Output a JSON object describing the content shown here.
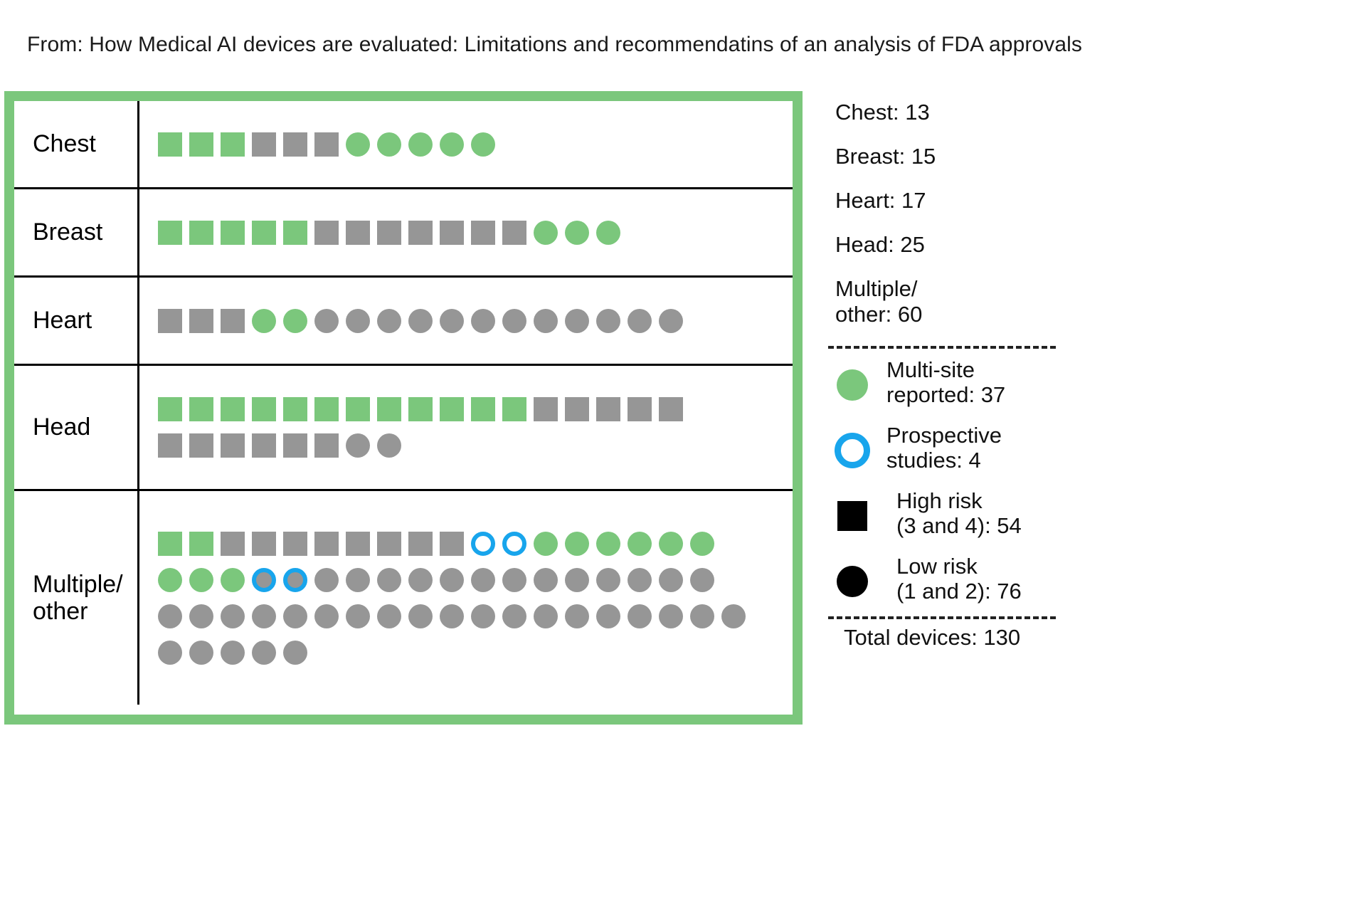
{
  "title": "From: How Medical AI devices are evaluated: Limitations and  recommendatins of an analysis of FDA approvals",
  "colors": {
    "green": "#7bc77c",
    "gray": "#969696",
    "blue": "#18a5ec",
    "black": "#000000"
  },
  "chart_data": {
    "type": "table",
    "title": "Medical AI device evaluations by body area",
    "categories": [
      "Chest",
      "Breast",
      "Heart",
      "Head",
      "Multiple/ other"
    ],
    "values": [
      13,
      15,
      17,
      25,
      60
    ],
    "legend": [
      "Multi-site reported",
      "Prospective studies",
      "High risk (3 and 4)",
      "Low risk (1 and 2)"
    ],
    "legend_values": [
      37,
      4,
      54,
      76
    ],
    "total": 130,
    "encoding": {
      "square": "High risk (3 and 4)",
      "circle": "Low risk (1 and 2)",
      "green_fill": "Multi-site reported",
      "gray_fill": "Not multi-site reported",
      "blue_ring": "Prospective study"
    }
  },
  "rows": [
    {
      "label": "Chest",
      "count": 13,
      "lines": [
        [
          {
            "shape": "sq",
            "fill": "green"
          },
          {
            "shape": "sq",
            "fill": "green"
          },
          {
            "shape": "sq",
            "fill": "green"
          },
          {
            "shape": "sq",
            "fill": "gray"
          },
          {
            "shape": "sq",
            "fill": "gray"
          },
          {
            "shape": "sq",
            "fill": "gray"
          },
          {
            "shape": "ci",
            "fill": "green"
          },
          {
            "shape": "ci",
            "fill": "green"
          },
          {
            "shape": "ci",
            "fill": "green"
          },
          {
            "shape": "ci",
            "fill": "green"
          },
          {
            "shape": "ci",
            "fill": "green"
          }
        ]
      ]
    },
    {
      "label": "Breast",
      "count": 15,
      "lines": [
        [
          {
            "shape": "sq",
            "fill": "green"
          },
          {
            "shape": "sq",
            "fill": "green"
          },
          {
            "shape": "sq",
            "fill": "green"
          },
          {
            "shape": "sq",
            "fill": "green"
          },
          {
            "shape": "sq",
            "fill": "green"
          },
          {
            "shape": "sq",
            "fill": "gray"
          },
          {
            "shape": "sq",
            "fill": "gray"
          },
          {
            "shape": "sq",
            "fill": "gray"
          },
          {
            "shape": "sq",
            "fill": "gray"
          },
          {
            "shape": "sq",
            "fill": "gray"
          },
          {
            "shape": "sq",
            "fill": "gray"
          },
          {
            "shape": "sq",
            "fill": "gray"
          },
          {
            "shape": "ci",
            "fill": "green"
          },
          {
            "shape": "ci",
            "fill": "green"
          },
          {
            "shape": "ci",
            "fill": "green"
          }
        ]
      ]
    },
    {
      "label": "Heart",
      "count": 17,
      "lines": [
        [
          {
            "shape": "sq",
            "fill": "gray"
          },
          {
            "shape": "sq",
            "fill": "gray"
          },
          {
            "shape": "sq",
            "fill": "gray"
          },
          {
            "shape": "ci",
            "fill": "green"
          },
          {
            "shape": "ci",
            "fill": "green"
          },
          {
            "shape": "ci",
            "fill": "gray"
          },
          {
            "shape": "ci",
            "fill": "gray"
          },
          {
            "shape": "ci",
            "fill": "gray"
          },
          {
            "shape": "ci",
            "fill": "gray"
          },
          {
            "shape": "ci",
            "fill": "gray"
          },
          {
            "shape": "ci",
            "fill": "gray"
          },
          {
            "shape": "ci",
            "fill": "gray"
          },
          {
            "shape": "ci",
            "fill": "gray"
          },
          {
            "shape": "ci",
            "fill": "gray"
          },
          {
            "shape": "ci",
            "fill": "gray"
          },
          {
            "shape": "ci",
            "fill": "gray"
          },
          {
            "shape": "ci",
            "fill": "gray"
          }
        ]
      ]
    },
    {
      "label": "Head",
      "count": 25,
      "lines": [
        [
          {
            "shape": "sq",
            "fill": "green"
          },
          {
            "shape": "sq",
            "fill": "green"
          },
          {
            "shape": "sq",
            "fill": "green"
          },
          {
            "shape": "sq",
            "fill": "green"
          },
          {
            "shape": "sq",
            "fill": "green"
          },
          {
            "shape": "sq",
            "fill": "green"
          },
          {
            "shape": "sq",
            "fill": "green"
          },
          {
            "shape": "sq",
            "fill": "green"
          },
          {
            "shape": "sq",
            "fill": "green"
          },
          {
            "shape": "sq",
            "fill": "green"
          },
          {
            "shape": "sq",
            "fill": "green"
          },
          {
            "shape": "sq",
            "fill": "green"
          },
          {
            "shape": "sq",
            "fill": "gray"
          },
          {
            "shape": "sq",
            "fill": "gray"
          },
          {
            "shape": "sq",
            "fill": "gray"
          },
          {
            "shape": "sq",
            "fill": "gray"
          },
          {
            "shape": "sq",
            "fill": "gray"
          }
        ],
        [
          {
            "shape": "sq",
            "fill": "gray"
          },
          {
            "shape": "sq",
            "fill": "gray"
          },
          {
            "shape": "sq",
            "fill": "gray"
          },
          {
            "shape": "sq",
            "fill": "gray"
          },
          {
            "shape": "sq",
            "fill": "gray"
          },
          {
            "shape": "sq",
            "fill": "gray"
          },
          {
            "shape": "ci",
            "fill": "gray"
          },
          {
            "shape": "ci",
            "fill": "gray"
          }
        ]
      ]
    },
    {
      "label": "Multiple/ other",
      "count": 60,
      "lines": [
        [
          {
            "shape": "sq",
            "fill": "green"
          },
          {
            "shape": "sq",
            "fill": "green"
          },
          {
            "shape": "sq",
            "fill": "gray"
          },
          {
            "shape": "sq",
            "fill": "gray"
          },
          {
            "shape": "sq",
            "fill": "gray"
          },
          {
            "shape": "sq",
            "fill": "gray"
          },
          {
            "shape": "sq",
            "fill": "gray"
          },
          {
            "shape": "sq",
            "fill": "gray"
          },
          {
            "shape": "sq",
            "fill": "gray"
          },
          {
            "shape": "sq",
            "fill": "gray"
          },
          {
            "shape": "ci",
            "fill": "none",
            "pros": true
          },
          {
            "shape": "ci",
            "fill": "none",
            "pros": true
          },
          {
            "shape": "ci",
            "fill": "green"
          },
          {
            "shape": "ci",
            "fill": "green"
          },
          {
            "shape": "ci",
            "fill": "green"
          },
          {
            "shape": "ci",
            "fill": "green"
          },
          {
            "shape": "ci",
            "fill": "green"
          },
          {
            "shape": "ci",
            "fill": "green"
          }
        ],
        [
          {
            "shape": "ci",
            "fill": "green"
          },
          {
            "shape": "ci",
            "fill": "green"
          },
          {
            "shape": "ci",
            "fill": "green"
          },
          {
            "shape": "ci",
            "fill": "gray",
            "pros": true
          },
          {
            "shape": "ci",
            "fill": "gray",
            "pros": true
          },
          {
            "shape": "ci",
            "fill": "gray"
          },
          {
            "shape": "ci",
            "fill": "gray"
          },
          {
            "shape": "ci",
            "fill": "gray"
          },
          {
            "shape": "ci",
            "fill": "gray"
          },
          {
            "shape": "ci",
            "fill": "gray"
          },
          {
            "shape": "ci",
            "fill": "gray"
          },
          {
            "shape": "ci",
            "fill": "gray"
          },
          {
            "shape": "ci",
            "fill": "gray"
          },
          {
            "shape": "ci",
            "fill": "gray"
          },
          {
            "shape": "ci",
            "fill": "gray"
          },
          {
            "shape": "ci",
            "fill": "gray"
          },
          {
            "shape": "ci",
            "fill": "gray"
          },
          {
            "shape": "ci",
            "fill": "gray"
          }
        ],
        [
          {
            "shape": "ci",
            "fill": "gray"
          },
          {
            "shape": "ci",
            "fill": "gray"
          },
          {
            "shape": "ci",
            "fill": "gray"
          },
          {
            "shape": "ci",
            "fill": "gray"
          },
          {
            "shape": "ci",
            "fill": "gray"
          },
          {
            "shape": "ci",
            "fill": "gray"
          },
          {
            "shape": "ci",
            "fill": "gray"
          },
          {
            "shape": "ci",
            "fill": "gray"
          },
          {
            "shape": "ci",
            "fill": "gray"
          },
          {
            "shape": "ci",
            "fill": "gray"
          },
          {
            "shape": "ci",
            "fill": "gray"
          },
          {
            "shape": "ci",
            "fill": "gray"
          },
          {
            "shape": "ci",
            "fill": "gray"
          },
          {
            "shape": "ci",
            "fill": "gray"
          },
          {
            "shape": "ci",
            "fill": "gray"
          },
          {
            "shape": "ci",
            "fill": "gray"
          },
          {
            "shape": "ci",
            "fill": "gray"
          },
          {
            "shape": "ci",
            "fill": "gray"
          },
          {
            "shape": "ci",
            "fill": "gray"
          }
        ],
        [
          {
            "shape": "ci",
            "fill": "gray"
          },
          {
            "shape": "ci",
            "fill": "gray"
          },
          {
            "shape": "ci",
            "fill": "gray"
          },
          {
            "shape": "ci",
            "fill": "gray"
          },
          {
            "shape": "ci",
            "fill": "gray"
          }
        ]
      ]
    }
  ],
  "sidebar": {
    "counts": [
      "Chest: 13",
      "Breast: 15",
      "Heart: 17",
      "Head: 25",
      "Multiple/\nother: 60"
    ],
    "legend": [
      {
        "symbol": "circle-green",
        "text": "Multi-site\nreported: 37"
      },
      {
        "symbol": "circle-blue-outline",
        "text": "Prospective\nstudies: 4"
      },
      {
        "symbol": "square-black",
        "text": "High risk\n(3 and 4): 54"
      },
      {
        "symbol": "circle-black",
        "text": "Low risk\n(1 and 2): 76"
      }
    ],
    "total": "Total devices: 130"
  }
}
